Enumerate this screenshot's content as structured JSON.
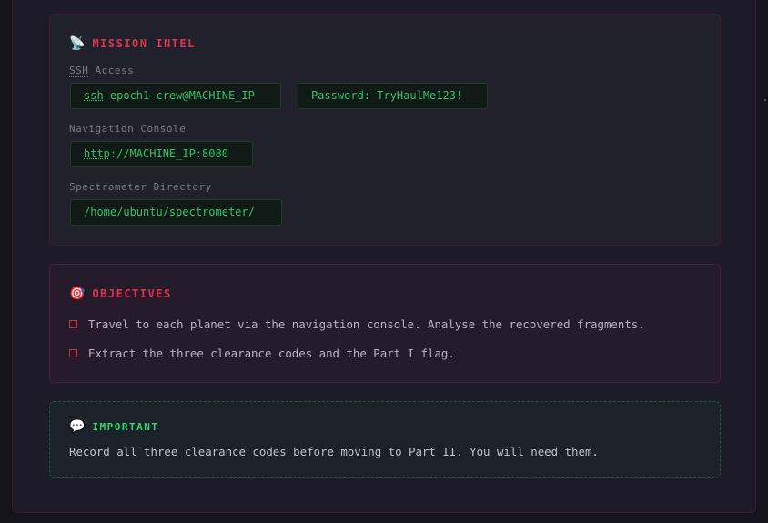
{
  "intel": {
    "icon": "satellite-dish-icon",
    "title": "MISSION INTEL",
    "ssh_label_abbr": "SSH",
    "ssh_label_rest": " Access",
    "ssh_cmd_prefix": "ssh",
    "ssh_cmd_rest": " epoch1-crew@MACHINE_IP",
    "password": "Password: TryHaulMe123!",
    "nav_label": "Navigation Console",
    "nav_url_prefix": "http",
    "nav_url_rest": "://MACHINE_IP:8080",
    "spectro_label": "Spectrometer Directory",
    "spectro_path": "/home/ubuntu/spectrometer/"
  },
  "objectives": {
    "icon": "target-icon",
    "title": "OBJECTIVES",
    "items": [
      "Travel to each planet via the navigation console. Analyse the recovered fragments.",
      "Extract the three clearance codes and the Part I flag."
    ]
  },
  "important": {
    "icon": "speech-bubble-icon",
    "title": "IMPORTANT",
    "text": "Record all three clearance codes before moving to Part II. You will need them."
  },
  "colors": {
    "accent_red": "#e0314f",
    "accent_green": "#33d66a",
    "code_text": "#33c266"
  }
}
